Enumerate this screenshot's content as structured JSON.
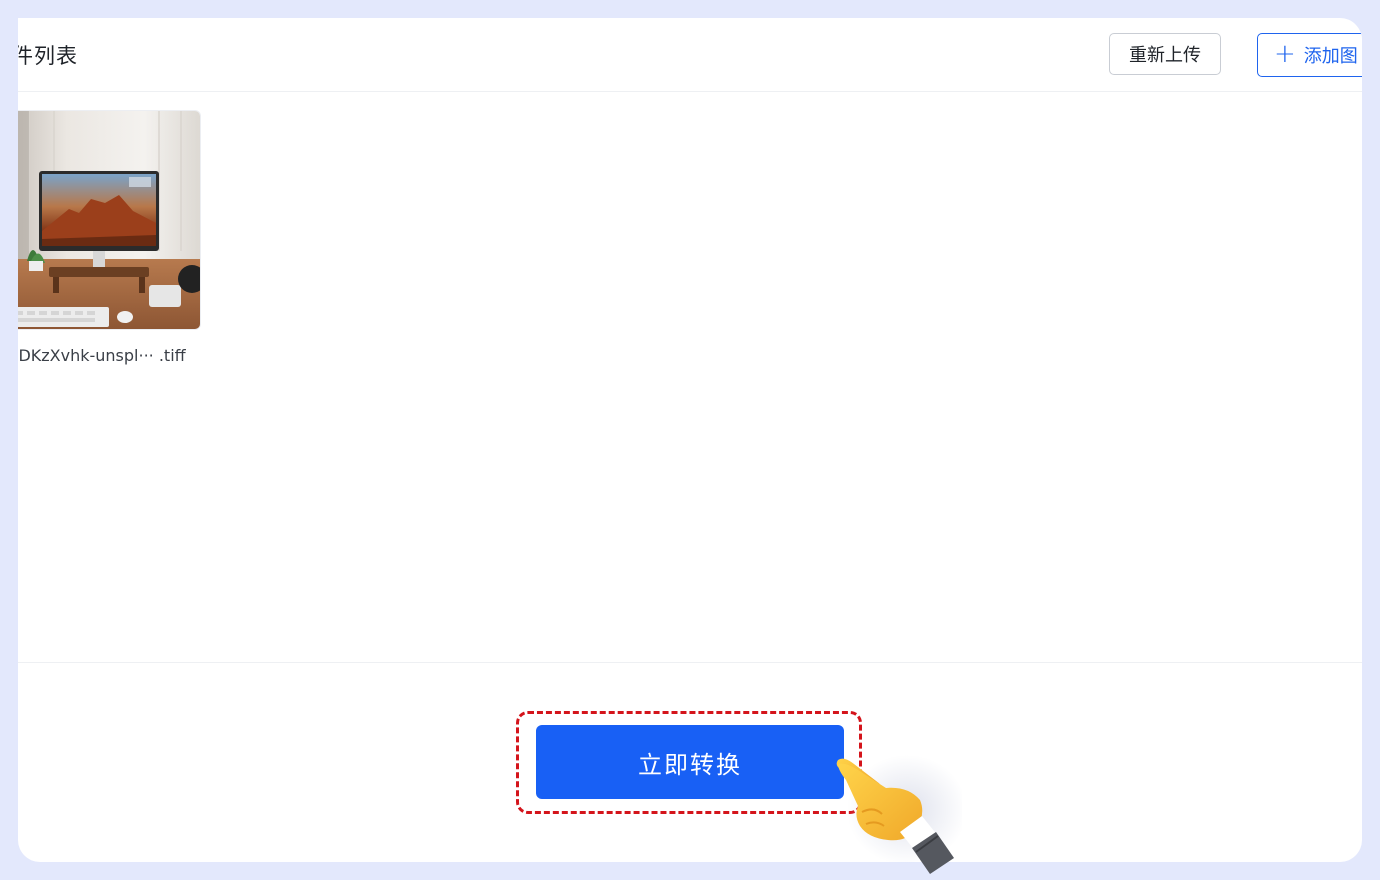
{
  "header": {
    "title": "件列表",
    "reupload_label": "重新上传",
    "add_label": "添加图",
    "add_icon": "plus-icon"
  },
  "files": [
    {
      "name": "lDKzXvhk-unspl··· .tiff",
      "thumbnail": "desk-monitor-photo"
    }
  ],
  "footer": {
    "convert_label": "立即转换",
    "highlight_color": "#d4141b",
    "accent_color": "#1860f5"
  },
  "pointer": {
    "icon": "pointing-hand-icon"
  }
}
